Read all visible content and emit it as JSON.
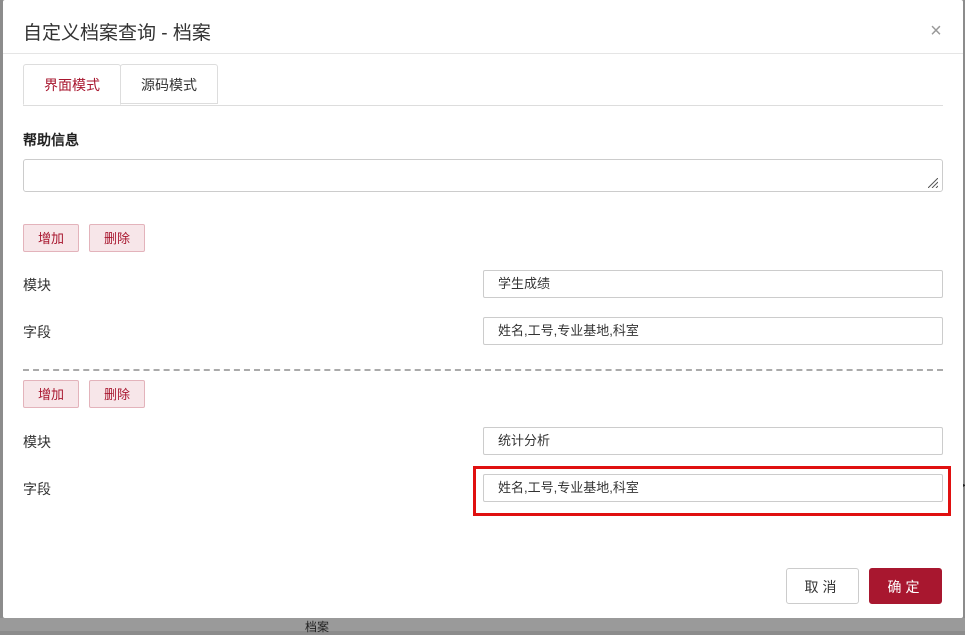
{
  "dialog": {
    "title": "自定义档案查询 - 档案",
    "close_glyph": "×"
  },
  "tabs": [
    {
      "label": "界面模式",
      "active": true
    },
    {
      "label": "源码模式",
      "active": false
    }
  ],
  "help": {
    "label": "帮助信息",
    "value": ""
  },
  "groups": [
    {
      "add_label": "增加",
      "delete_label": "删除",
      "module_label": "模块",
      "module_value": "学生成绩",
      "field_label": "字段",
      "field_value": "姓名,工号,专业基地,科室"
    },
    {
      "add_label": "增加",
      "delete_label": "删除",
      "module_label": "模块",
      "module_value": "统计分析",
      "field_label": "字段",
      "field_value": "姓名,工号,专业基地,科室"
    }
  ],
  "footer": {
    "cancel_label": "取消",
    "confirm_label": "确定"
  },
  "background": {
    "partial_text": "档案"
  },
  "colors": {
    "accent": "#a8172f",
    "highlight": "#e01010"
  }
}
